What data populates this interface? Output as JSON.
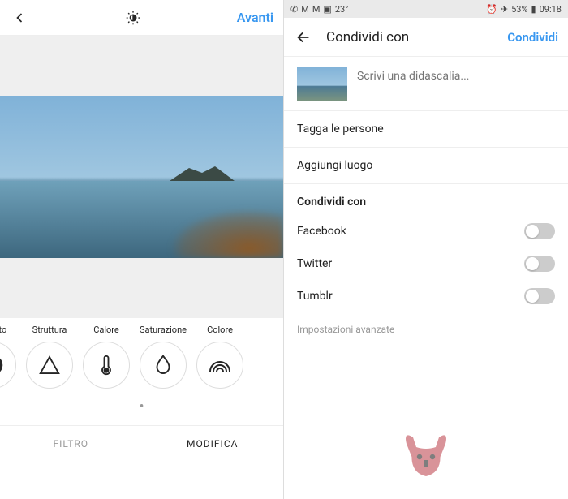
{
  "left": {
    "header": {
      "next": "Avanti"
    },
    "tools": [
      {
        "label": "ntrasto"
      },
      {
        "label": "Struttura"
      },
      {
        "label": "Calore"
      },
      {
        "label": "Saturazione"
      },
      {
        "label": "Colore"
      }
    ],
    "tabs": {
      "filter": "FILTRO",
      "edit": "MODIFICA"
    }
  },
  "right": {
    "status": {
      "temp": "23°",
      "battery": "53%",
      "time": "09:18"
    },
    "header": {
      "title": "Condividi con",
      "action": "Condividi"
    },
    "caption_placeholder": "Scrivi una didascalia...",
    "rows": {
      "tag": "Tagga le persone",
      "location": "Aggiungi luogo"
    },
    "share": {
      "section": "Condividi con",
      "items": [
        {
          "label": "Facebook"
        },
        {
          "label": "Twitter"
        },
        {
          "label": "Tumblr"
        }
      ]
    },
    "advanced": "Impostazioni avanzate"
  }
}
